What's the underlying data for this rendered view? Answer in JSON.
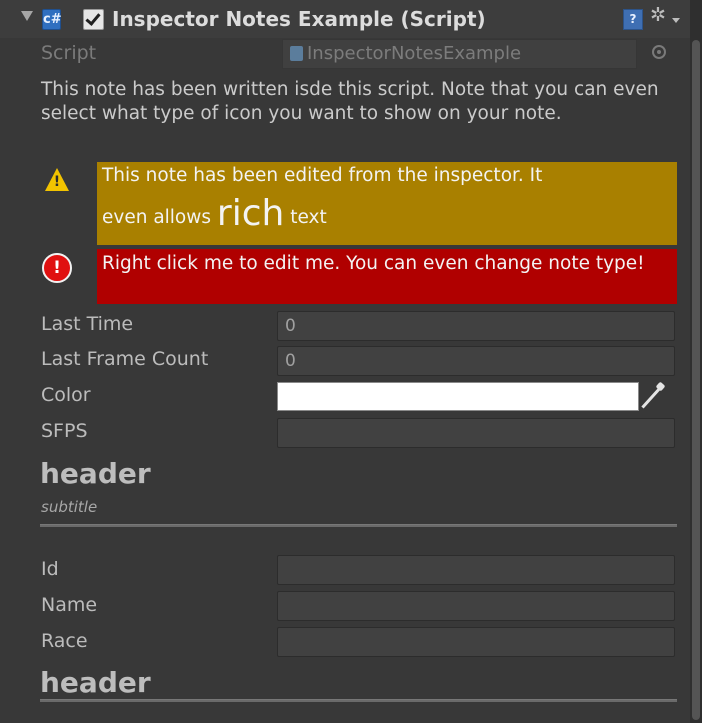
{
  "component": {
    "title": "Inspector Notes Example (Script)",
    "script_icon_glyph": "c#",
    "help_glyph": "?",
    "gear_glyph": "✲",
    "enabled": true
  },
  "script_field": {
    "label": "Script",
    "value": "InspectorNotesExample"
  },
  "notes": {
    "plain": "This note has been written isde this script. Note that you can even select what type of icon you want to show on your note.",
    "warning": {
      "line1": "This note has been edited from the inspector. It",
      "line2_prefix": "even allows ",
      "line2_rich": "rich",
      "line2_suffix": " text",
      "icon_mark": "!",
      "background": "#a98000"
    },
    "error": {
      "text": "Right click me to edit me. You can even change note  type!",
      "icon_mark": "!",
      "background": "#b00000"
    }
  },
  "fields": {
    "last_time": {
      "label": "Last Time",
      "value": "0"
    },
    "last_frame_count": {
      "label": "Last Frame Count",
      "value": "0"
    },
    "color": {
      "label": "Color",
      "value": "#ffffff"
    },
    "sfps": {
      "label": "SFPS",
      "value": ""
    }
  },
  "section1": {
    "header": "header",
    "subtitle": "subtitle"
  },
  "fields2": {
    "id": {
      "label": "Id",
      "value": ""
    },
    "name": {
      "label": "Name",
      "value": ""
    },
    "race": {
      "label": "Race",
      "value": ""
    }
  },
  "section2": {
    "header": "header"
  }
}
